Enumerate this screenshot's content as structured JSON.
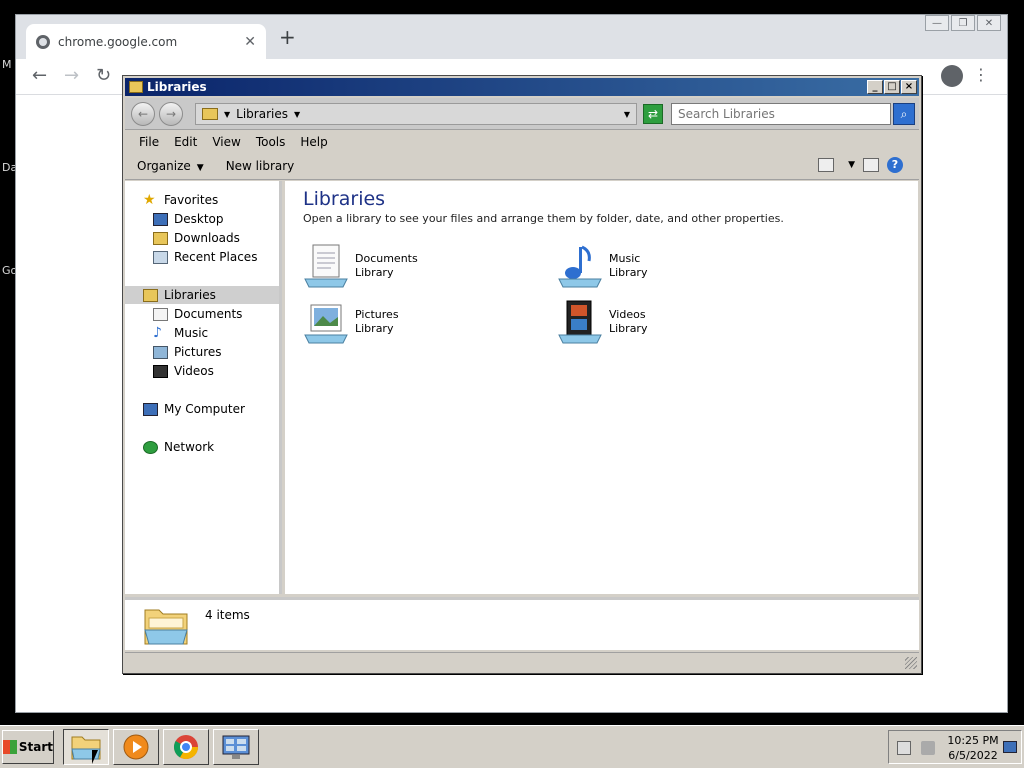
{
  "desktop": {
    "fragments": [
      "M",
      "Da",
      "Go"
    ]
  },
  "chrome": {
    "tab_title": "chrome.google.com",
    "new_tab_symbol": "+",
    "back_symbol": "←",
    "forward_symbol": "→",
    "reload_symbol": "↻",
    "menu_symbol": "⋮",
    "close_tab_symbol": "✕",
    "window_buttons": [
      "—",
      "❐",
      "✕"
    ]
  },
  "explorer": {
    "title": "Libraries",
    "address_text": "Libraries",
    "search_placeholder": "Search Libraries",
    "menu": [
      "File",
      "Edit",
      "View",
      "Tools",
      "Help"
    ],
    "commands": {
      "organize": "Organize",
      "new_library": "New library"
    },
    "nav": {
      "favorites": "Favorites",
      "desktop": "Desktop",
      "downloads": "Downloads",
      "recent_places": "Recent Places",
      "libraries": "Libraries",
      "documents": "Documents",
      "music": "Music",
      "pictures": "Pictures",
      "videos": "Videos",
      "my_computer": "My Computer",
      "network": "Network"
    },
    "content_title": "Libraries",
    "content_subtitle": "Open a library to see your files and arrange them by folder, date, and other properties.",
    "libraries": [
      {
        "name": "Documents",
        "type": "Library"
      },
      {
        "name": "Music",
        "type": "Library"
      },
      {
        "name": "Pictures",
        "type": "Library"
      },
      {
        "name": "Videos",
        "type": "Library"
      }
    ],
    "item_count": "4 items"
  },
  "taskbar": {
    "start_label": "Start",
    "time": "10:25 PM",
    "date": "6/5/2022"
  },
  "colors": {
    "title_bar": "#0a246a",
    "accent_green": "#2e9e3f",
    "accent_blue": "#2e6fd0"
  }
}
